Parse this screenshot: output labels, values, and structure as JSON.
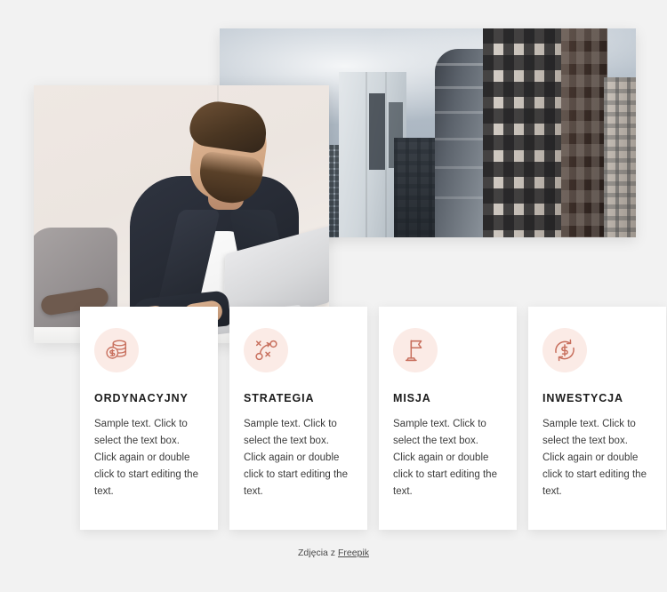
{
  "page": {
    "background_color": "#f2f2f2",
    "accent_color": "#c8705e",
    "icon_circle_color": "#fbebe6"
  },
  "media": {
    "city_photo": {
      "alt": "city-skyline-photo",
      "description": "Modern office skyscrapers against a cloudy grey sky"
    },
    "person_photo": {
      "alt": "businessman-laptop-photo",
      "description": "Bearded man in a dark blazer and white t-shirt working on a silver laptop"
    }
  },
  "cards": [
    {
      "icon": "coin-stack-icon",
      "title": "ORDYNACYJNY",
      "text": "Sample text. Click to select the text box. Click again or double click to start editing the text."
    },
    {
      "icon": "strategy-icon",
      "title": "STRATEGIA",
      "text": "Sample text. Click to select the text box. Click again or double click to start editing the text."
    },
    {
      "icon": "flag-icon",
      "title": "MISJA",
      "text": "Sample text. Click to select the text box. Click again or double click to start editing the text."
    },
    {
      "icon": "money-exchange-icon",
      "title": "INWESTYCJA",
      "text": "Sample text. Click to select the text box. Click again or double click to start editing the text."
    }
  ],
  "footer": {
    "prefix": "Zdjęcia z ",
    "link_label": "Freepik"
  }
}
